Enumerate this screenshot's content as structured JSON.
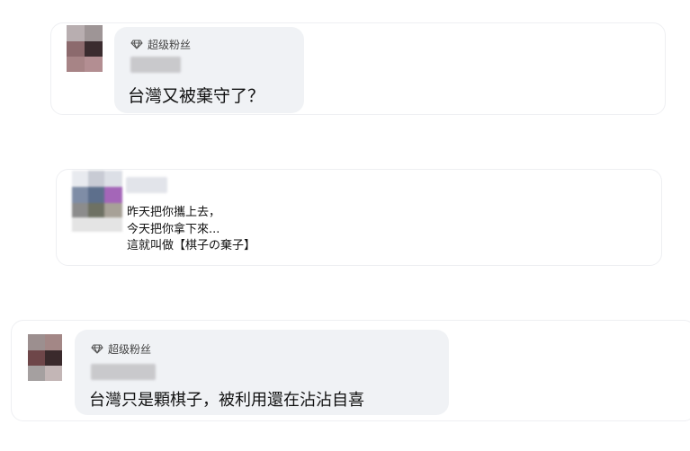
{
  "comments": [
    {
      "badge": "超级粉丝",
      "badge_icon": "diamond-icon",
      "author_name": "",
      "text": "台灣又被棄守了？"
    },
    {
      "badge": "",
      "author_name": "",
      "lines": [
        "昨天把你攜上去，",
        "今天把你拿下來...",
        "這就叫做【棋子の棄子】"
      ]
    },
    {
      "badge": "超级粉丝",
      "badge_icon": "diamond-icon",
      "author_name": "",
      "text": "台灣只是顆棋子，被利用還在沾沾自喜"
    }
  ]
}
